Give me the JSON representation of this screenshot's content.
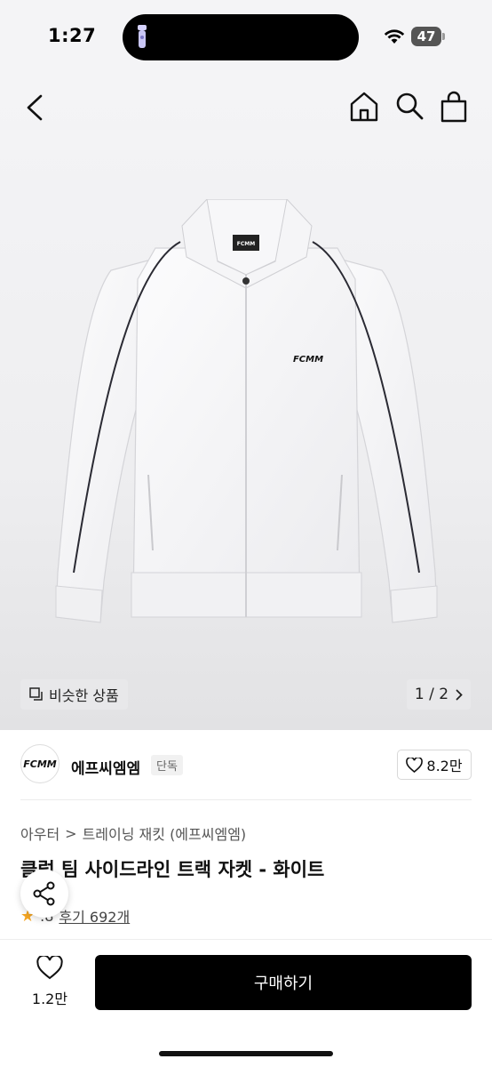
{
  "status_bar": {
    "time": "1:27",
    "battery": "47"
  },
  "product_image": {
    "similar_label": "비슷한 상품",
    "pager": {
      "current": "1",
      "separator": "/",
      "total": "2"
    },
    "logo_chest": "FCMM",
    "logo_collar": "FCMM"
  },
  "brand": {
    "logo_text": "FCMM",
    "name": "에프씨엠엠",
    "badge": "단독",
    "likes": "8.2만"
  },
  "breadcrumb": {
    "category": "아우터",
    "separator": ">",
    "subcategory": "트레이닝 재킷 (에프씨엠엠)"
  },
  "product": {
    "title": "클럽 팀 사이드라인 트랙 자켓 - 화이트",
    "rating": ".8",
    "reviews": "후기 692개"
  },
  "bottom_bar": {
    "wish_count": "1.2만",
    "buy_label": "구매하기"
  },
  "colors": {
    "primary": "#000000",
    "star": "#f5a623",
    "background": "#f4f4f6"
  },
  "icons": [
    "back-icon",
    "home-icon",
    "search-icon",
    "shopping-bag-icon",
    "similar-icon",
    "chevron-right-icon",
    "heart-icon",
    "share-icon",
    "star-icon"
  ]
}
